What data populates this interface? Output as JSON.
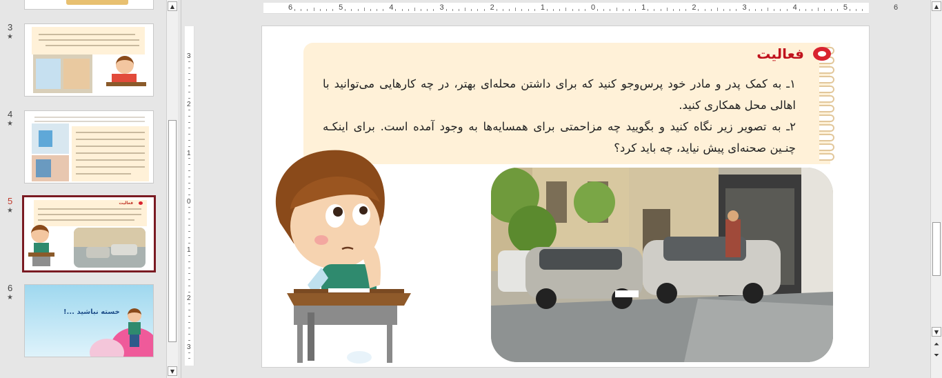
{
  "thumbnails": [
    {
      "number": "3",
      "star": "★",
      "title": "",
      "active": false
    },
    {
      "number": "4",
      "star": "★",
      "title": "",
      "active": false
    },
    {
      "number": "5",
      "star": "★",
      "title": "فعالیت",
      "active": true
    },
    {
      "number": "6",
      "star": "★",
      "title": "خسته نباشید ...!",
      "active": false
    }
  ],
  "ruler": {
    "top": [
      "6",
      "5",
      "4",
      "3",
      "2",
      "1",
      "0",
      "1",
      "2",
      "3",
      "4",
      "5",
      "6"
    ],
    "left": [
      "3",
      "2",
      "1",
      "0",
      "1",
      "2",
      "3"
    ]
  },
  "slide": {
    "activity_title": "فعالیت",
    "items": [
      "١ـ به کمک پدر و مادر خود پرس‌وجو کنید که برای داشتن محله‌ای بهتر، در چه کارهایی می‌توانید با اهالی محل همکاری کنید.",
      "٢ـ به تصویر زیر نگاه کنید و بگویید چه مزاحمتی برای همسایه‌ها به وجود آمده است. برای اینکـه چنـین صحنه‌ای پیش نیاید، چه باید کرد؟"
    ]
  },
  "icons": {
    "scroll_up": "triangle-up-icon",
    "scroll_down": "triangle-down-icon",
    "prev_slide": "double-up-icon",
    "next_slide": "double-down-icon"
  },
  "colors": {
    "accent_red": "#c0131d",
    "selected_border": "#7a1a22",
    "activity_bg": "#fff1d8"
  }
}
